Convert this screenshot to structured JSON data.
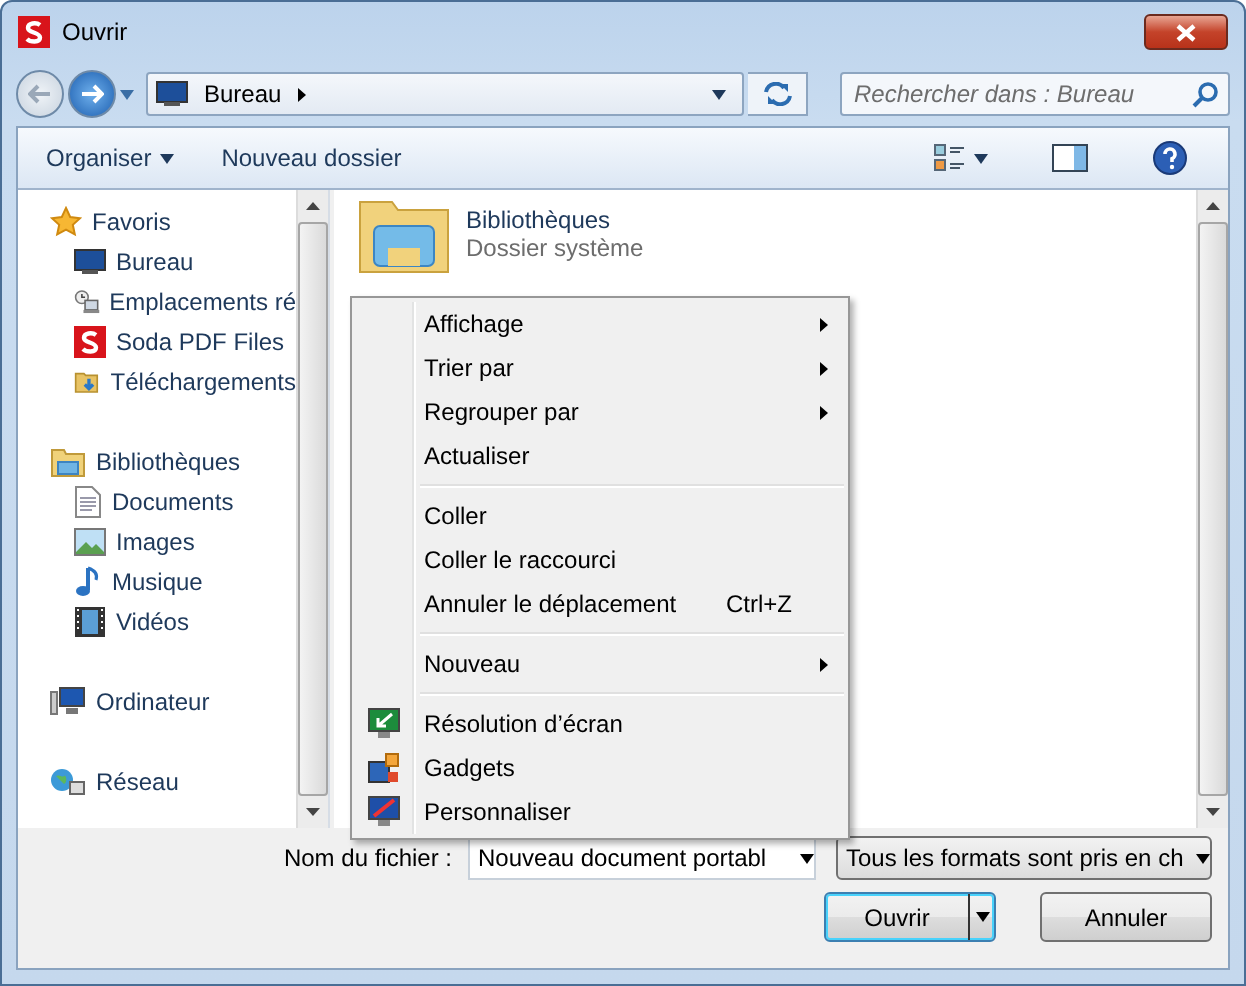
{
  "window": {
    "title": "Ouvrir"
  },
  "navigation": {
    "path": "Bureau",
    "search": {
      "placeholder": "Rechercher dans : Bureau"
    }
  },
  "toolbar": {
    "items": [
      {
        "label": "Organiser",
        "kind": "dropdown"
      },
      {
        "label": "Nouveau dossier",
        "kind": "plain"
      }
    ]
  },
  "sidebar": {
    "groups": [
      {
        "label": "Favoris",
        "kind": "star",
        "children": [
          {
            "label": "Bureau",
            "kind": "desktop"
          },
          {
            "label": "Emplacements ré",
            "kind": "recent"
          },
          {
            "label": "Soda PDF Files",
            "kind": "soda"
          },
          {
            "label": "Téléchargements",
            "kind": "download"
          }
        ]
      },
      {
        "label": "Bibliothèques",
        "kind": "library",
        "children": [
          {
            "label": "Documents",
            "kind": "document"
          },
          {
            "label": "Images",
            "kind": "image"
          },
          {
            "label": "Musique",
            "kind": "music"
          },
          {
            "label": "Vidéos",
            "kind": "video"
          }
        ]
      },
      {
        "label": "Ordinateur",
        "kind": "computer"
      },
      {
        "label": "Réseau",
        "kind": "network"
      }
    ]
  },
  "files": [
    {
      "name": "Bibliothèques",
      "type": "Dossier système"
    }
  ],
  "context_menu": {
    "groups": [
      [
        {
          "label": "Affichage",
          "submenu": true
        },
        {
          "label": "Trier par",
          "submenu": true
        },
        {
          "label": "Regrouper par",
          "submenu": true
        },
        {
          "label": "Actualiser",
          "submenu": false
        }
      ],
      [
        {
          "label": "Coller",
          "submenu": false
        },
        {
          "label": "Coller le raccourci",
          "submenu": false
        },
        {
          "label": "Annuler le déplacement",
          "submenu": false,
          "shortcut": "Ctrl+Z"
        }
      ],
      [
        {
          "label": "Nouveau",
          "submenu": true
        }
      ],
      [
        {
          "label": "Résolution d’écran",
          "submenu": false,
          "kind": "screen"
        },
        {
          "label": "Gadgets",
          "submenu": false,
          "kind": "gadgets"
        },
        {
          "label": "Personnaliser",
          "submenu": false,
          "kind": "personalize"
        }
      ]
    ]
  },
  "footer": {
    "filename_label": "Nom du fichier :",
    "filename": "Nouveau document portabl",
    "filter": "Tous les formats sont pris en ch",
    "buttons": [
      {
        "label": "Ouvrir",
        "kind": "split"
      },
      {
        "label": "Annuler",
        "kind": "plain"
      }
    ]
  }
}
